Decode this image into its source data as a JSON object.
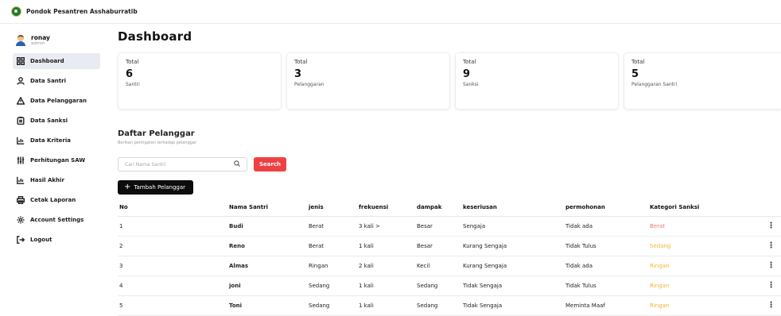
{
  "app": {
    "title": "Pondok Pesantren Asshaburratib"
  },
  "user": {
    "name": "ronay",
    "role": "admin"
  },
  "sidebar": {
    "items": [
      {
        "label": "Dashboard",
        "icon": "grid-icon",
        "active": true
      },
      {
        "label": "Data Santri",
        "icon": "user-icon"
      },
      {
        "label": "Data Pelanggaran",
        "icon": "warning-icon"
      },
      {
        "label": "Data Sanksi",
        "icon": "clipboard-icon"
      },
      {
        "label": "Data Kriteria",
        "icon": "chart-icon"
      },
      {
        "label": "Perhitungan SAW",
        "icon": "sliders-icon"
      },
      {
        "label": "Hasil Akhir",
        "icon": "chart-icon"
      },
      {
        "label": "Cetak Laporan",
        "icon": "printer-icon"
      },
      {
        "label": "Account Settings",
        "icon": "gear-icon"
      },
      {
        "label": "Logout",
        "icon": "logout-icon"
      }
    ]
  },
  "page": {
    "title": "Dashboard"
  },
  "cards": [
    {
      "label": "Total",
      "value": "6",
      "sub": "Santri"
    },
    {
      "label": "Total",
      "value": "3",
      "sub": "Pelanggaran"
    },
    {
      "label": "Total",
      "value": "9",
      "sub": "Sanksi"
    },
    {
      "label": "Total",
      "value": "5",
      "sub": "Pelanggaran Santri"
    }
  ],
  "section": {
    "title": "Daftar Pelanggar",
    "subtitle": "Berikan peringatan terhadap pelanggar"
  },
  "search": {
    "placeholder": "Cari Nama Santri",
    "button": "Search"
  },
  "add_button": "Tambah Pelanggar",
  "table": {
    "headers": [
      "No",
      "Nama Santri",
      "jenis",
      "frekuensi",
      "dampak",
      "keseriusan",
      "permohonan",
      "Kategori Sanksi"
    ],
    "rows": [
      {
        "no": "1",
        "nama": "Budi",
        "jenis": "Berat",
        "frekuensi": "3 kali >",
        "dampak": "Besar",
        "keseriusan": "Sengaja",
        "permohonan": "Tidak ada",
        "kategori": "Berat"
      },
      {
        "no": "2",
        "nama": "Reno",
        "jenis": "Berat",
        "frekuensi": "1 kali",
        "dampak": "Besar",
        "keseriusan": "Kurang Sengaja",
        "permohonan": "Tidak Tulus",
        "kategori": "Sedang"
      },
      {
        "no": "3",
        "nama": "Almas",
        "jenis": "Ringan",
        "frekuensi": "2 kali",
        "dampak": "Kecil",
        "keseriusan": "Kurang Sengaja",
        "permohonan": "Tidak ada",
        "kategori": "Ringan"
      },
      {
        "no": "4",
        "nama": "joni",
        "jenis": "Sedang",
        "frekuensi": "1 kali",
        "dampak": "Sedang",
        "keseriusan": "Tidak Sengaja",
        "permohonan": "Tidak Tulus",
        "kategori": "Ringan"
      },
      {
        "no": "5",
        "nama": "Toni",
        "jenis": "Sedang",
        "frekuensi": "1 kali",
        "dampak": "Sedang",
        "keseriusan": "Tidak Sengaja",
        "permohonan": "Meminta Maaf",
        "kategori": "Ringan"
      }
    ]
  },
  "colors": {
    "danger": "#ef4141",
    "berat": "#f07575",
    "sedang": "#f0b43c",
    "active_bg": "#e8ebf1"
  }
}
